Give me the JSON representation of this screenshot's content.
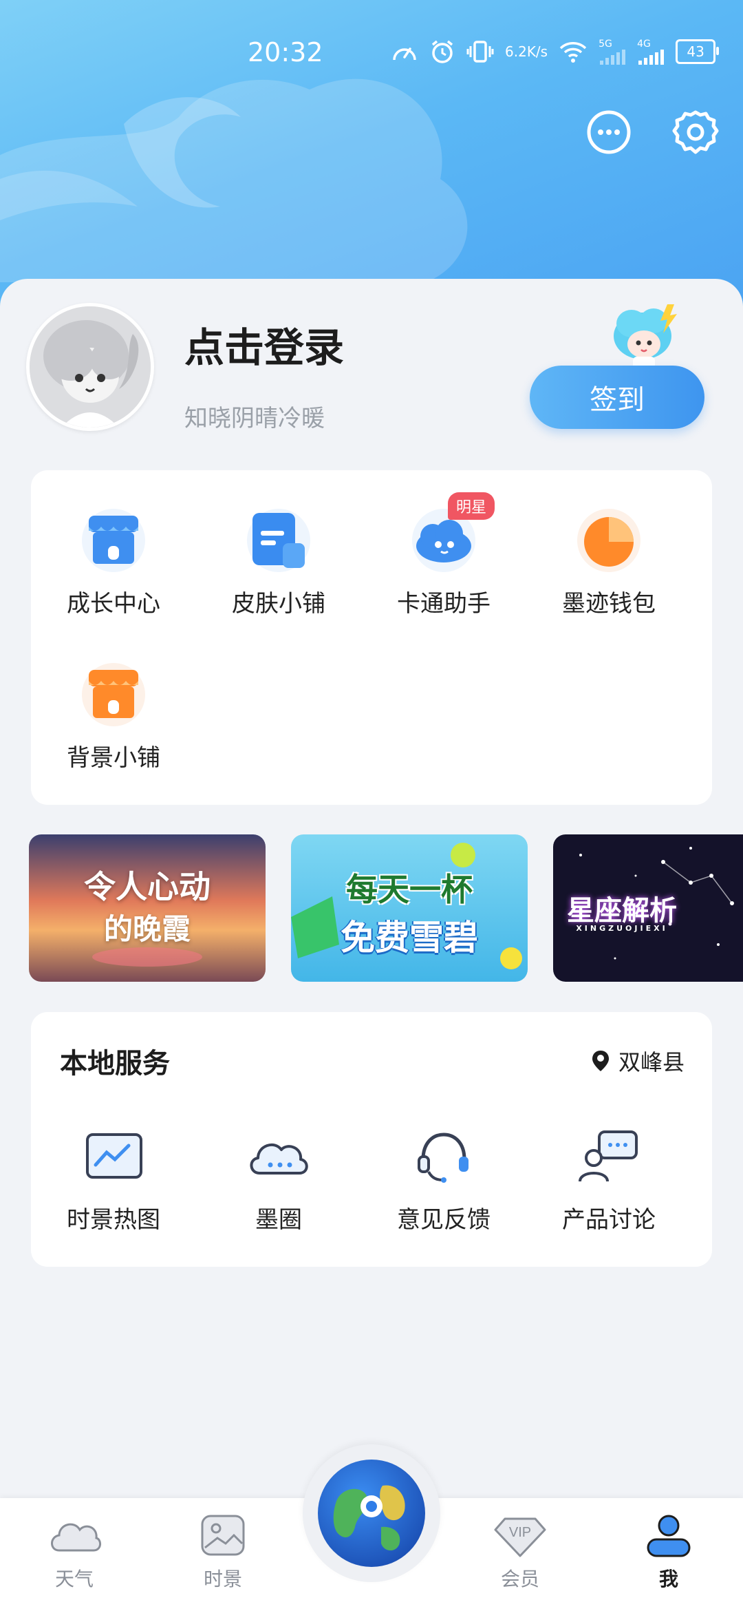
{
  "status_bar": {
    "time": "20:32",
    "net_speed_value": "6.2",
    "net_speed_unit": "K/s",
    "battery": "43",
    "net_5g": "5G",
    "net_4g": "4G"
  },
  "header": {
    "message_icon": "chat-bubble-icon",
    "settings_icon": "gear-icon"
  },
  "profile": {
    "login_title": "点击登录",
    "subtitle": "知晓阴晴冷暖",
    "signin_label": "签到"
  },
  "features": [
    {
      "label": "成长中心",
      "icon": "store-icon",
      "badge": ""
    },
    {
      "label": "皮肤小铺",
      "icon": "document-icon",
      "badge": ""
    },
    {
      "label": "卡通助手",
      "icon": "cartoon-cloud-icon",
      "badge": "明星"
    },
    {
      "label": "墨迹钱包",
      "icon": "pie-wallet-icon",
      "badge": ""
    },
    {
      "label": "背景小铺",
      "icon": "store-orange-icon",
      "badge": ""
    }
  ],
  "banners": [
    {
      "text_line1": "令人心动",
      "text_line2": "的晚霞"
    },
    {
      "text_line1": "每天一杯",
      "text_line2": "免费雪碧"
    },
    {
      "text_line1": "星座解析",
      "text_line2": "XINGZUOJIEXI"
    }
  ],
  "local_services": {
    "title": "本地服务",
    "location": "双峰县",
    "items": [
      {
        "label": "时景热图",
        "icon": "image-chart-icon"
      },
      {
        "label": "墨圈",
        "icon": "cloud-dots-icon"
      },
      {
        "label": "意见反馈",
        "icon": "headset-icon"
      },
      {
        "label": "产品讨论",
        "icon": "discussion-icon"
      }
    ]
  },
  "bottom_nav": [
    {
      "label": "天气",
      "icon": "cloud-icon",
      "active": false
    },
    {
      "label": "时景",
      "icon": "picture-icon",
      "active": false
    },
    {
      "label": "会员",
      "icon": "vip-diamond-icon",
      "active": false
    },
    {
      "label": "我",
      "icon": "person-icon",
      "active": true
    }
  ],
  "colors": {
    "accent": "#3e95ef",
    "badge": "#f05662",
    "header_gradient_start": "#7fd0f7",
    "header_gradient_end": "#4aa2f2"
  }
}
